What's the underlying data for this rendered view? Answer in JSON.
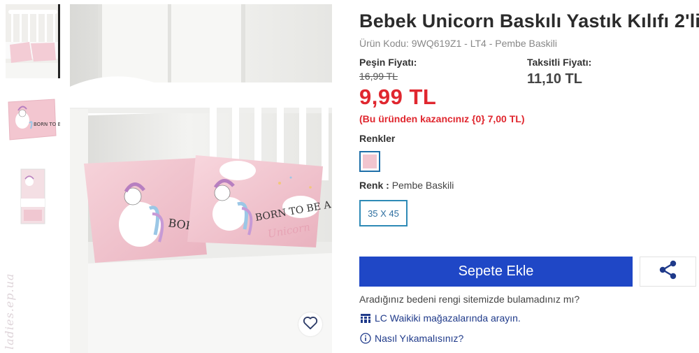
{
  "product": {
    "title": "Bebek Unicorn Baskılı Yastık Kılıfı 2'li",
    "code": "Ürün Kodu: 9WQ619Z1 - LT4 - Pembe Baskili"
  },
  "pricing": {
    "cash_label": "Peşin Fiyatı:",
    "old_price": "16,99 TL",
    "price": "9,99 TL",
    "saving": "(Bu üründen kazancınız {0} 7,00 TL)",
    "installment_label": "Taksitli Fiyatı:",
    "installment_price": "11,10 TL"
  },
  "colors": {
    "label": "Renkler",
    "selected_label": "Renk :",
    "selected_value": "Pembe Baskili",
    "swatch_color": "#f2c5cf"
  },
  "sizes": {
    "selected": "35 X 45"
  },
  "actions": {
    "add_to_cart": "Sepete Ekle",
    "not_found": "Aradığınız bedeni rengi sitemizde bulamadınız mı?",
    "store_link": "LC Waikiki mağazalarında arayın.",
    "wash_link": "Nasıl Yıkamalısınız?"
  },
  "image": {
    "pillow_left_text": "BORN TO BE",
    "pillow_right_text_1": "BORN TO BE A",
    "pillow_right_text_2": "Unicorn",
    "thumb2_text": "BORN TO BE",
    "watermark": "ladies.ep.ua"
  },
  "theme": {
    "accent_blue": "#1f47c6",
    "price_red": "#e0272f",
    "link_blue": "#1f3a8a"
  },
  "icons": [
    "heart-icon",
    "share-icon",
    "store-icon",
    "info-icon"
  ]
}
